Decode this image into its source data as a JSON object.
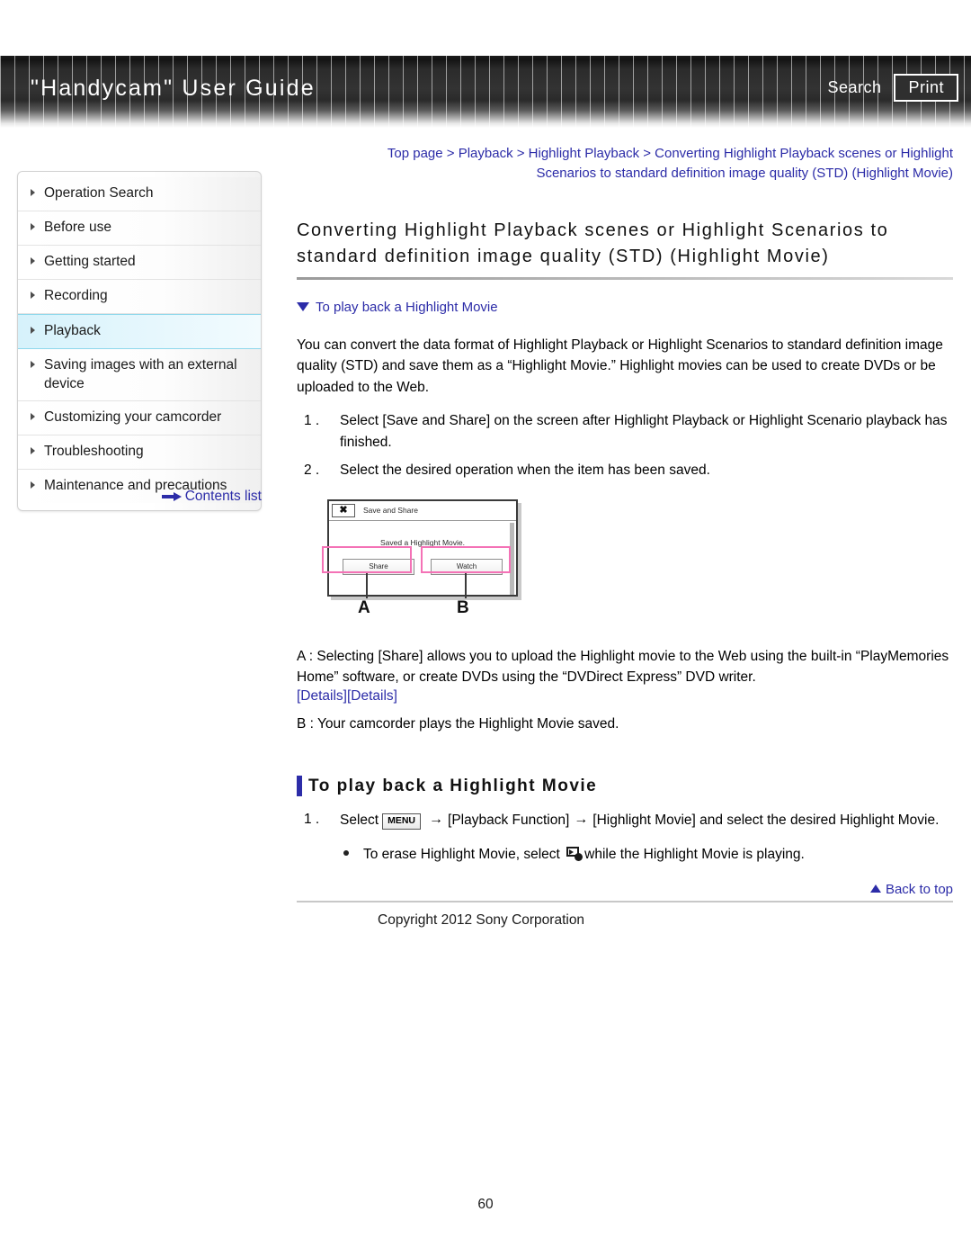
{
  "header": {
    "title": "\"Handycam\" User Guide",
    "search_label": "Search",
    "print_label": "Print"
  },
  "sidebar": {
    "items": [
      {
        "label": "Operation Search",
        "active": false
      },
      {
        "label": "Before use",
        "active": false
      },
      {
        "label": "Getting started",
        "active": false
      },
      {
        "label": "Recording",
        "active": false
      },
      {
        "label": "Playback",
        "active": true
      },
      {
        "label": "Saving images with an external device",
        "active": false
      },
      {
        "label": "Customizing your camcorder",
        "active": false
      },
      {
        "label": "Troubleshooting",
        "active": false
      },
      {
        "label": "Maintenance and precautions",
        "active": false
      }
    ],
    "contents_list_label": "Contents list"
  },
  "main": {
    "breadcrumb_line1": "Top page > Playback > Highlight Playback > Converting Highlight Playback scenes or Highlight",
    "breadcrumb_line2": "Scenarios to standard definition image quality (STD) (Highlight Movie)",
    "heading": "Converting Highlight Playback scenes or Highlight Scenarios to standard definition image quality (STD) (Highlight Movie)",
    "jump_link": "To play back a Highlight Movie",
    "intro": "You can convert the data format of Highlight Playback or Highlight Scenarios to standard definition image quality (STD) and save them as a “Highlight Movie.” Highlight movies can be used to create DVDs or be uploaded to the Web.",
    "steps": [
      {
        "num": "1 .",
        "text": "Select [Save and Share] on the screen after Highlight Playback or Highlight Scenario playback has finished."
      },
      {
        "num": "2 .",
        "text": "Select the desired operation when the item has been saved."
      }
    ],
    "figure": {
      "close_icon_label": "✖",
      "screen_title": "Save and Share",
      "screen_message": "Saved a Highlight Movie.",
      "button_share": "Share",
      "button_watch": "Watch",
      "callout_a": "A",
      "callout_b": "B"
    },
    "ab_description_a": "A : Selecting [Share] allows you to upload the Highlight movie to the Web using the built-in “PlayMemories Home” software, or create DVDs using the “DVDirect Express” DVD writer.",
    "details_link_1": "[Details]",
    "details_link_2": "[Details]",
    "ab_description_b": "B : Your camcorder plays the Highlight Movie saved.",
    "section_title": "To play back a Highlight Movie",
    "play_step_num": "1 .",
    "play_step_prefix": "Select",
    "menu_chip": "MENU",
    "arrow_1": "→",
    "play_step_mid": "[Playback Function]",
    "arrow_2": "→",
    "play_step_suffix": "[Highlight Movie] and select the desired Highlight Movie.",
    "bullet_prefix": "To erase Highlight Movie, select",
    "bullet_suffix": "while the Highlight Movie is playing."
  },
  "footer": {
    "back_to_top": "Back to top",
    "copyright": "Copyright 2012 Sony Corporation",
    "page_number": "60"
  }
}
